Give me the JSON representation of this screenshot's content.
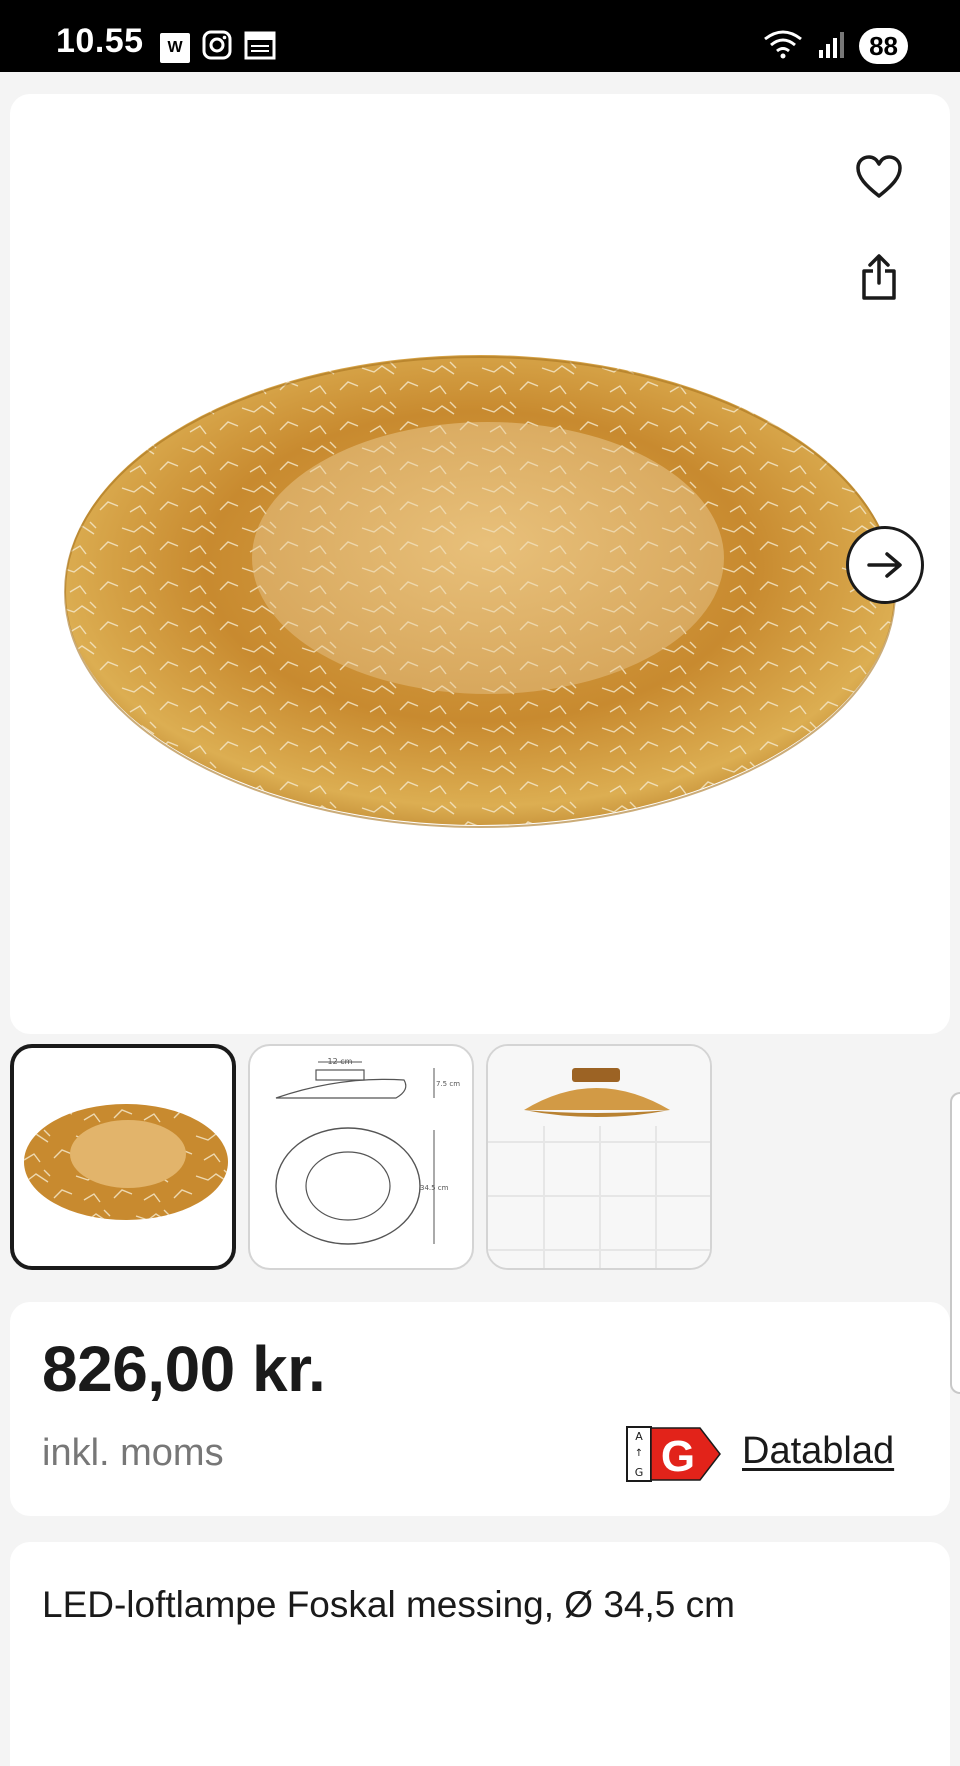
{
  "status_bar": {
    "time": "10.55",
    "app_icon_1": "W",
    "battery": "88"
  },
  "product": {
    "main_image": "gold-leaf-ceiling-lamp",
    "price": "826,00 kr.",
    "vat_note": "inkl. moms",
    "energy_label": {
      "scale_top": "A",
      "scale_bottom": "G",
      "class": "G",
      "color": "#e2231a"
    },
    "datasheet_link": "Datablad",
    "title": "LED-loftlampe Foskal messing, Ø 34,5 cm"
  },
  "thumbnails": [
    {
      "name": "lamp-front"
    },
    {
      "name": "dimension-drawing",
      "width_label": "12 cm",
      "height_label": "7.5 cm",
      "diameter_label": "34.5 cm"
    },
    {
      "name": "lamp-mounted"
    }
  ],
  "icons": {
    "favorite": "heart-icon",
    "share": "share-icon",
    "next": "arrow-right-icon"
  }
}
